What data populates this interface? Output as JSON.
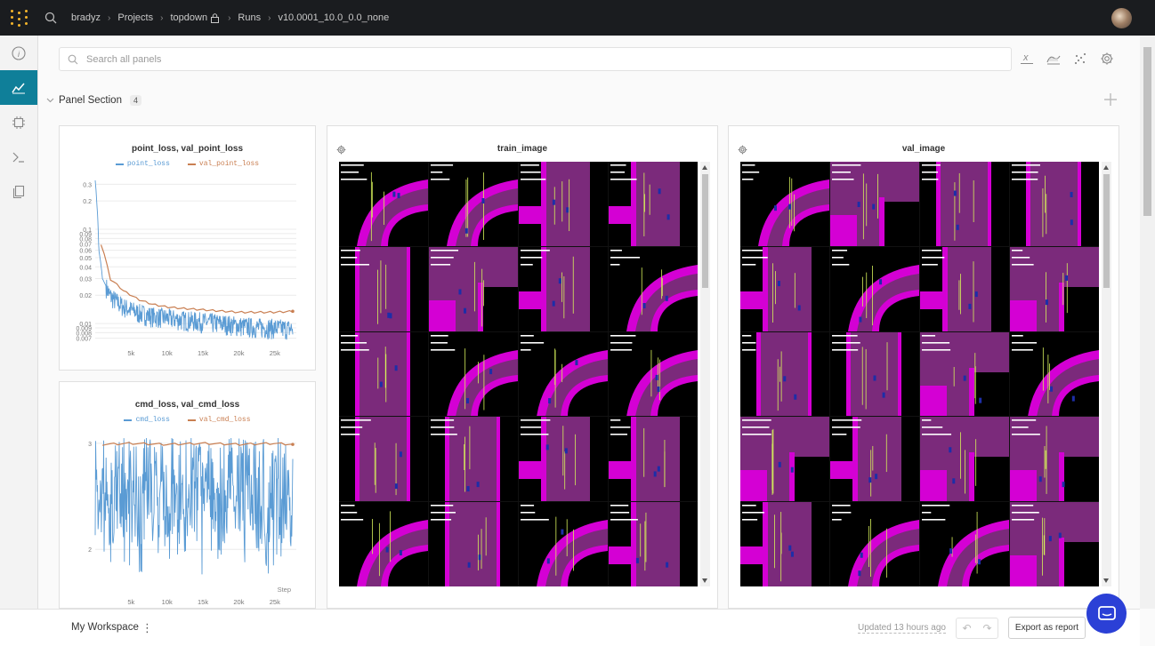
{
  "breadcrumbs": [
    "bradyz",
    "Projects",
    "topdown",
    "Runs",
    "v10.0001_10.0_0.0_none"
  ],
  "search": {
    "placeholder": "Search all panels"
  },
  "section": {
    "title": "Panel Section",
    "count": "4"
  },
  "panels": {
    "point_loss": {
      "title": "point_loss, val_point_loss",
      "legend": [
        "point_loss",
        "val_point_loss"
      ],
      "colors": [
        "#5a9bd4",
        "#c97f52"
      ]
    },
    "cmd_loss": {
      "title": "cmd_loss, val_cmd_loss",
      "legend": [
        "cmd_loss",
        "val_cmd_loss"
      ],
      "colors": [
        "#5a9bd4",
        "#c97f52"
      ]
    },
    "train_image": {
      "title": "train_image"
    },
    "val_image": {
      "title": "val_image"
    }
  },
  "chart_data": [
    {
      "type": "line",
      "title": "point_loss, val_point_loss",
      "xlabel": "",
      "ylabel": "",
      "y_scale": "log",
      "x_ticks": [
        "5k",
        "10k",
        "15k",
        "20k",
        "25k"
      ],
      "y_ticks": [
        "0.3",
        "0.2",
        "0.1",
        "0.09",
        "0.08",
        "0.07",
        "0.06",
        "0.05",
        "0.04",
        "0.03",
        "0.02",
        "0.01",
        "0.009",
        "0.008",
        "0.007"
      ],
      "series": [
        {
          "name": "point_loss",
          "x": [
            0,
            200,
            500,
            1000,
            2000,
            3000,
            4000,
            6000,
            8000,
            10000,
            12000,
            15000,
            18000,
            20000,
            22000,
            25000,
            27500
          ],
          "y": [
            0.33,
            0.2,
            0.06,
            0.03,
            0.02,
            0.017,
            0.015,
            0.013,
            0.012,
            0.0115,
            0.011,
            0.0105,
            0.01,
            0.0095,
            0.0092,
            0.009,
            0.0088
          ]
        },
        {
          "name": "val_point_loss",
          "x": [
            800,
            2000,
            4000,
            6000,
            8000,
            10000,
            12000,
            15000,
            18000,
            20000,
            22000,
            25000,
            27500
          ],
          "y": [
            0.07,
            0.03,
            0.022,
            0.018,
            0.016,
            0.015,
            0.0145,
            0.014,
            0.0135,
            0.0132,
            0.0132,
            0.0132,
            0.0135
          ]
        }
      ],
      "xlim": [
        0,
        28000
      ]
    },
    {
      "type": "line",
      "title": "cmd_loss, val_cmd_loss",
      "xlabel": "Step",
      "ylabel": "",
      "x_ticks": [
        "5k",
        "10k",
        "15k",
        "20k",
        "25k"
      ],
      "y_ticks": [
        "3",
        "2"
      ],
      "series": [
        {
          "name": "cmd_loss",
          "x": [
            0,
            27500
          ],
          "y_range": [
            1.75,
            3.05
          ]
        },
        {
          "name": "val_cmd_loss",
          "x": [
            1000,
            5000,
            10000,
            15000,
            20000,
            25000,
            27500
          ],
          "y": [
            2.99,
            3.0,
            2.99,
            3.0,
            2.99,
            3.0,
            2.99
          ]
        }
      ],
      "xlim": [
        0,
        28000
      ],
      "ylim": [
        1.7,
        3.1
      ]
    }
  ],
  "footer": {
    "workspace": "My Workspace",
    "updated": "Updated 13 hours ago",
    "export_label": "Export as report"
  },
  "icons": [
    "wandb-logo-icon",
    "search-icon",
    "lock-icon",
    "info-icon",
    "chart-icon",
    "chip-icon",
    "terminal-icon",
    "files-icon",
    "x-axis-icon",
    "smoothing-icon",
    "outliers-icon",
    "gear-icon",
    "plus-icon",
    "chat-icon"
  ]
}
